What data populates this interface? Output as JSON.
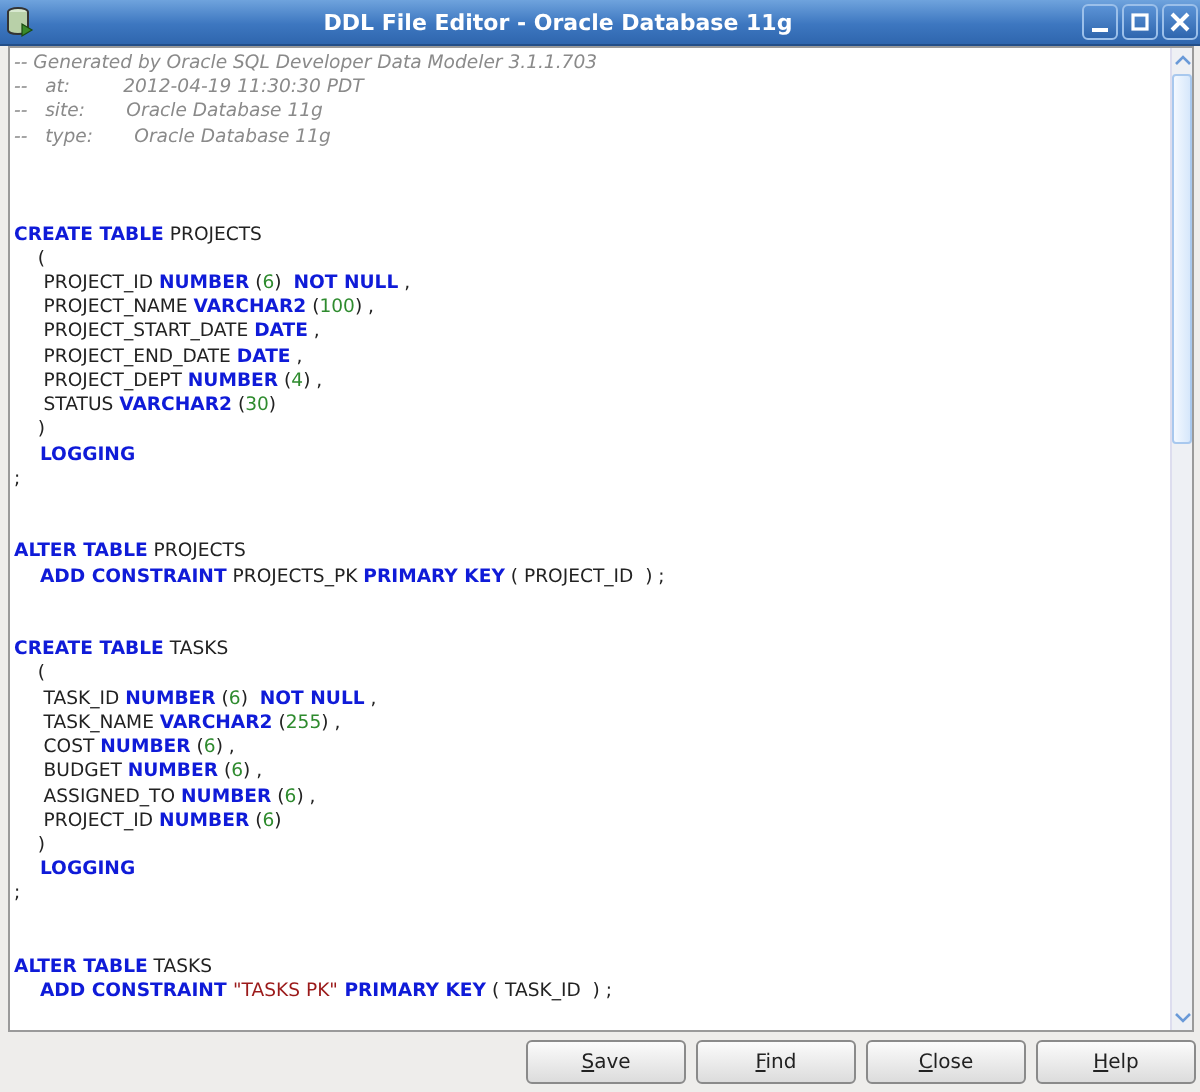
{
  "window": {
    "title": "DDL File Editor - Oracle Database 11g"
  },
  "editor": {
    "lines": [
      {
        "kind": "code",
        "tokens": [
          {
            "kind": "comment",
            "text": "-- Generated by Oracle SQL Developer Data Modeler 3.1.1.703"
          }
        ]
      },
      {
        "kind": "code",
        "tokens": [
          {
            "kind": "comment",
            "text": "--   at:         2012-04-19 11:30:30 PDT"
          }
        ]
      },
      {
        "kind": "code",
        "tokens": [
          {
            "kind": "comment",
            "text": "--   site:       Oracle Database 11g"
          }
        ]
      },
      {
        "kind": "code",
        "tokens": [
          {
            "kind": "comment",
            "text": "--   type:       Oracle Database 11g"
          }
        ]
      },
      {
        "kind": "blank"
      },
      {
        "kind": "blank"
      },
      {
        "kind": "blank"
      },
      {
        "kind": "code",
        "tokens": [
          {
            "kind": "keyword",
            "text": "CREATE TABLE"
          },
          {
            "kind": "plain",
            "text": " PROJECTS"
          }
        ]
      },
      {
        "kind": "code",
        "tokens": [
          {
            "kind": "plain",
            "text": "    ("
          }
        ]
      },
      {
        "kind": "code",
        "tokens": [
          {
            "kind": "plain",
            "text": "     PROJECT_ID "
          },
          {
            "kind": "keyword",
            "text": "NUMBER"
          },
          {
            "kind": "plain",
            "text": " ("
          },
          {
            "kind": "number",
            "text": "6"
          },
          {
            "kind": "plain",
            "text": ")  "
          },
          {
            "kind": "keyword",
            "text": "NOT NULL"
          },
          {
            "kind": "plain",
            "text": " ,"
          }
        ]
      },
      {
        "kind": "code",
        "tokens": [
          {
            "kind": "plain",
            "text": "     PROJECT_NAME "
          },
          {
            "kind": "keyword",
            "text": "VARCHAR2"
          },
          {
            "kind": "plain",
            "text": " ("
          },
          {
            "kind": "number",
            "text": "100"
          },
          {
            "kind": "plain",
            "text": ") ,"
          }
        ]
      },
      {
        "kind": "code",
        "tokens": [
          {
            "kind": "plain",
            "text": "     PROJECT_START_DATE "
          },
          {
            "kind": "keyword",
            "text": "DATE"
          },
          {
            "kind": "plain",
            "text": " ,"
          }
        ]
      },
      {
        "kind": "code",
        "tokens": [
          {
            "kind": "plain",
            "text": "     PROJECT_END_DATE "
          },
          {
            "kind": "keyword",
            "text": "DATE"
          },
          {
            "kind": "plain",
            "text": " ,"
          }
        ]
      },
      {
        "kind": "code",
        "tokens": [
          {
            "kind": "plain",
            "text": "     PROJECT_DEPT "
          },
          {
            "kind": "keyword",
            "text": "NUMBER"
          },
          {
            "kind": "plain",
            "text": " ("
          },
          {
            "kind": "number",
            "text": "4"
          },
          {
            "kind": "plain",
            "text": ") ,"
          }
        ]
      },
      {
        "kind": "code",
        "tokens": [
          {
            "kind": "plain",
            "text": "     STATUS "
          },
          {
            "kind": "keyword",
            "text": "VARCHAR2"
          },
          {
            "kind": "plain",
            "text": " ("
          },
          {
            "kind": "number",
            "text": "30"
          },
          {
            "kind": "plain",
            "text": ")"
          }
        ]
      },
      {
        "kind": "code",
        "tokens": [
          {
            "kind": "plain",
            "text": "    )"
          }
        ]
      },
      {
        "kind": "code",
        "tokens": [
          {
            "kind": "keyword",
            "text": "    LOGGING"
          }
        ]
      },
      {
        "kind": "code",
        "tokens": [
          {
            "kind": "plain",
            "text": ";"
          }
        ]
      },
      {
        "kind": "blank"
      },
      {
        "kind": "blank"
      },
      {
        "kind": "code",
        "tokens": [
          {
            "kind": "keyword",
            "text": "ALTER TABLE"
          },
          {
            "kind": "plain",
            "text": " PROJECTS"
          }
        ]
      },
      {
        "kind": "code",
        "tokens": [
          {
            "kind": "keyword",
            "text": "    ADD CONSTRAINT"
          },
          {
            "kind": "plain",
            "text": " PROJECTS_PK "
          },
          {
            "kind": "keyword",
            "text": "PRIMARY KEY"
          },
          {
            "kind": "plain",
            "text": " ( PROJECT_ID  ) ;"
          }
        ]
      },
      {
        "kind": "blank"
      },
      {
        "kind": "blank"
      },
      {
        "kind": "code",
        "tokens": [
          {
            "kind": "keyword",
            "text": "CREATE TABLE"
          },
          {
            "kind": "plain",
            "text": " TASKS"
          }
        ]
      },
      {
        "kind": "code",
        "tokens": [
          {
            "kind": "plain",
            "text": "    ("
          }
        ]
      },
      {
        "kind": "code",
        "tokens": [
          {
            "kind": "plain",
            "text": "     TASK_ID "
          },
          {
            "kind": "keyword",
            "text": "NUMBER"
          },
          {
            "kind": "plain",
            "text": " ("
          },
          {
            "kind": "number",
            "text": "6"
          },
          {
            "kind": "plain",
            "text": ")  "
          },
          {
            "kind": "keyword",
            "text": "NOT NULL"
          },
          {
            "kind": "plain",
            "text": " ,"
          }
        ]
      },
      {
        "kind": "code",
        "tokens": [
          {
            "kind": "plain",
            "text": "     TASK_NAME "
          },
          {
            "kind": "keyword",
            "text": "VARCHAR2"
          },
          {
            "kind": "plain",
            "text": " ("
          },
          {
            "kind": "number",
            "text": "255"
          },
          {
            "kind": "plain",
            "text": ") ,"
          }
        ]
      },
      {
        "kind": "code",
        "tokens": [
          {
            "kind": "plain",
            "text": "     COST "
          },
          {
            "kind": "keyword",
            "text": "NUMBER"
          },
          {
            "kind": "plain",
            "text": " ("
          },
          {
            "kind": "number",
            "text": "6"
          },
          {
            "kind": "plain",
            "text": ") ,"
          }
        ]
      },
      {
        "kind": "code",
        "tokens": [
          {
            "kind": "plain",
            "text": "     BUDGET "
          },
          {
            "kind": "keyword",
            "text": "NUMBER"
          },
          {
            "kind": "plain",
            "text": " ("
          },
          {
            "kind": "number",
            "text": "6"
          },
          {
            "kind": "plain",
            "text": ") ,"
          }
        ]
      },
      {
        "kind": "code",
        "tokens": [
          {
            "kind": "plain",
            "text": "     ASSIGNED_TO "
          },
          {
            "kind": "keyword",
            "text": "NUMBER"
          },
          {
            "kind": "plain",
            "text": " ("
          },
          {
            "kind": "number",
            "text": "6"
          },
          {
            "kind": "plain",
            "text": ") ,"
          }
        ]
      },
      {
        "kind": "code",
        "tokens": [
          {
            "kind": "plain",
            "text": "     PROJECT_ID "
          },
          {
            "kind": "keyword",
            "text": "NUMBER"
          },
          {
            "kind": "plain",
            "text": " ("
          },
          {
            "kind": "number",
            "text": "6"
          },
          {
            "kind": "plain",
            "text": ")"
          }
        ]
      },
      {
        "kind": "code",
        "tokens": [
          {
            "kind": "plain",
            "text": "    )"
          }
        ]
      },
      {
        "kind": "code",
        "tokens": [
          {
            "kind": "keyword",
            "text": "    LOGGING"
          }
        ]
      },
      {
        "kind": "code",
        "tokens": [
          {
            "kind": "plain",
            "text": ";"
          }
        ]
      },
      {
        "kind": "blank"
      },
      {
        "kind": "blank"
      },
      {
        "kind": "code",
        "tokens": [
          {
            "kind": "keyword",
            "text": "ALTER TABLE"
          },
          {
            "kind": "plain",
            "text": " TASKS"
          }
        ]
      },
      {
        "kind": "code",
        "tokens": [
          {
            "kind": "keyword",
            "text": "    ADD CONSTRAINT "
          },
          {
            "kind": "string",
            "text": "\"TASKS PK\""
          },
          {
            "kind": "keyword",
            "text": " PRIMARY KEY"
          },
          {
            "kind": "plain",
            "text": " ( TASK_ID  ) ;"
          }
        ]
      }
    ]
  },
  "buttons": [
    {
      "mnemonic": "S",
      "rest": "ave"
    },
    {
      "mnemonic": "F",
      "rest": "ind"
    },
    {
      "mnemonic": "C",
      "rest": "lose"
    },
    {
      "mnemonic": "H",
      "rest": "elp"
    }
  ]
}
